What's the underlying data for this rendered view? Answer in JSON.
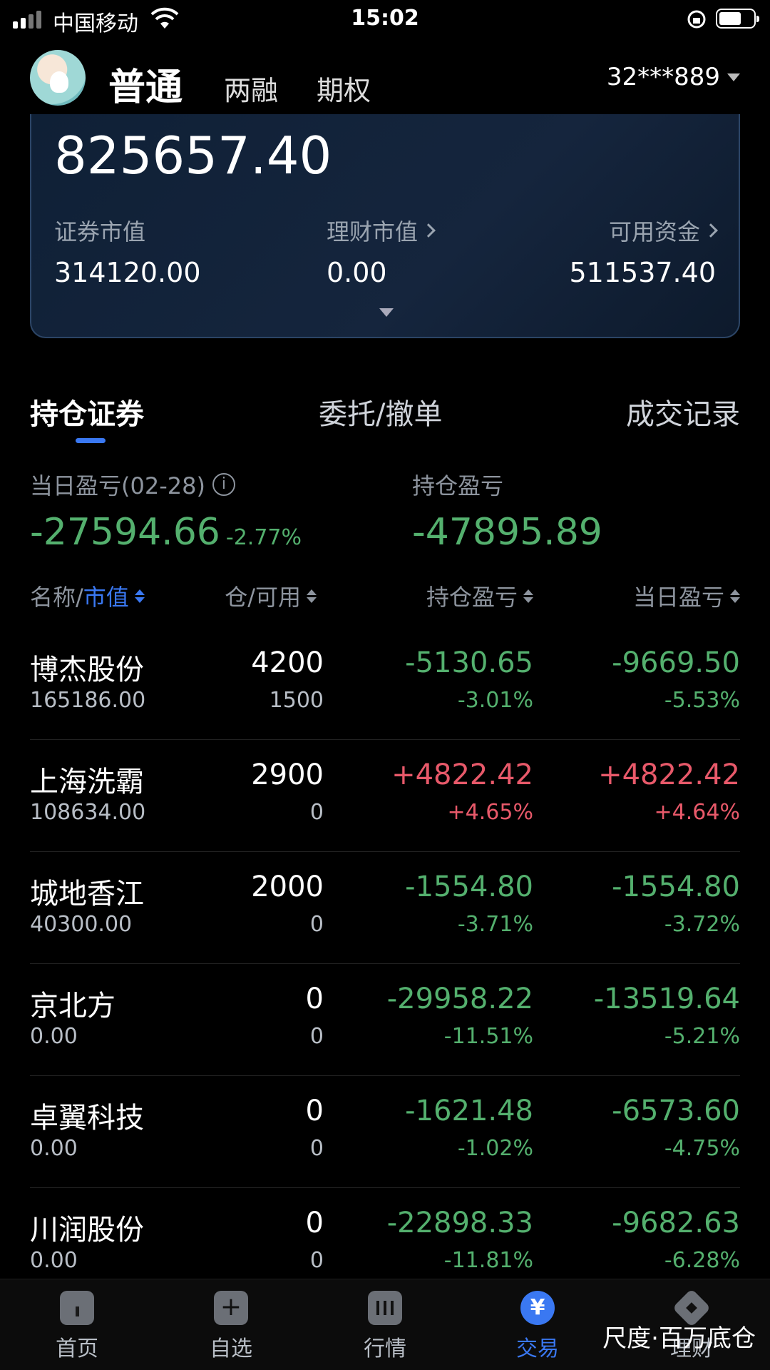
{
  "status": {
    "carrier": "中国移动",
    "time": "15:02"
  },
  "header": {
    "tabs": [
      "普通",
      "两融",
      "期权"
    ],
    "account": "32***889"
  },
  "asset": {
    "total": "825657.40",
    "metrics": [
      {
        "label": "证券市值",
        "value": "314120.00"
      },
      {
        "label": "理财市值",
        "value": "0.00"
      },
      {
        "label": "可用资金",
        "value": "511537.40"
      }
    ]
  },
  "section_tabs": [
    "持仓证券",
    "委托/撤单",
    "成交记录"
  ],
  "summary": {
    "daily_label": "当日盈亏(02-28)",
    "daily_value": "-27594.66",
    "daily_pct": "-2.77%",
    "holding_label": "持仓盈亏",
    "holding_value": "-47895.89"
  },
  "columns": {
    "name": "名称/",
    "market_value": "市值",
    "position": "仓/可用",
    "holding_pl": "持仓盈亏",
    "daily_pl": "当日盈亏"
  },
  "rows": [
    {
      "name": "博杰股份",
      "mv": "165186.00",
      "qty": "4200",
      "avail": "1500",
      "pl": "-5130.65",
      "plp": "-3.01%",
      "dp": "-9669.50",
      "dpp": "-5.53%"
    },
    {
      "name": "上海洗霸",
      "mv": "108634.00",
      "qty": "2900",
      "avail": "0",
      "pl": "+4822.42",
      "plp": "+4.65%",
      "dp": "+4822.42",
      "dpp": "+4.64%"
    },
    {
      "name": "城地香江",
      "mv": "40300.00",
      "qty": "2000",
      "avail": "0",
      "pl": "-1554.80",
      "plp": "-3.71%",
      "dp": "-1554.80",
      "dpp": "-3.72%"
    },
    {
      "name": "京北方",
      "mv": "0.00",
      "qty": "0",
      "avail": "0",
      "pl": "-29958.22",
      "plp": "-11.51%",
      "dp": "-13519.64",
      "dpp": "-5.21%"
    },
    {
      "name": "卓翼科技",
      "mv": "0.00",
      "qty": "0",
      "avail": "0",
      "pl": "-1621.48",
      "plp": "-1.02%",
      "dp": "-6573.60",
      "dpp": "-4.75%"
    },
    {
      "name": "川润股份",
      "mv": "0.00",
      "qty": "0",
      "avail": "0",
      "pl": "-22898.33",
      "plp": "-11.81%",
      "dp": "-9682.63",
      "dpp": "-6.28%"
    }
  ],
  "nav": [
    "首页",
    "自选",
    "行情",
    "交易",
    "理财"
  ],
  "nav_active_glyph": "¥",
  "watermark": "尺度·百万底仓",
  "colors": {
    "gain": "#e8596a",
    "loss": "#54b06e",
    "accent": "#3a78f2"
  }
}
